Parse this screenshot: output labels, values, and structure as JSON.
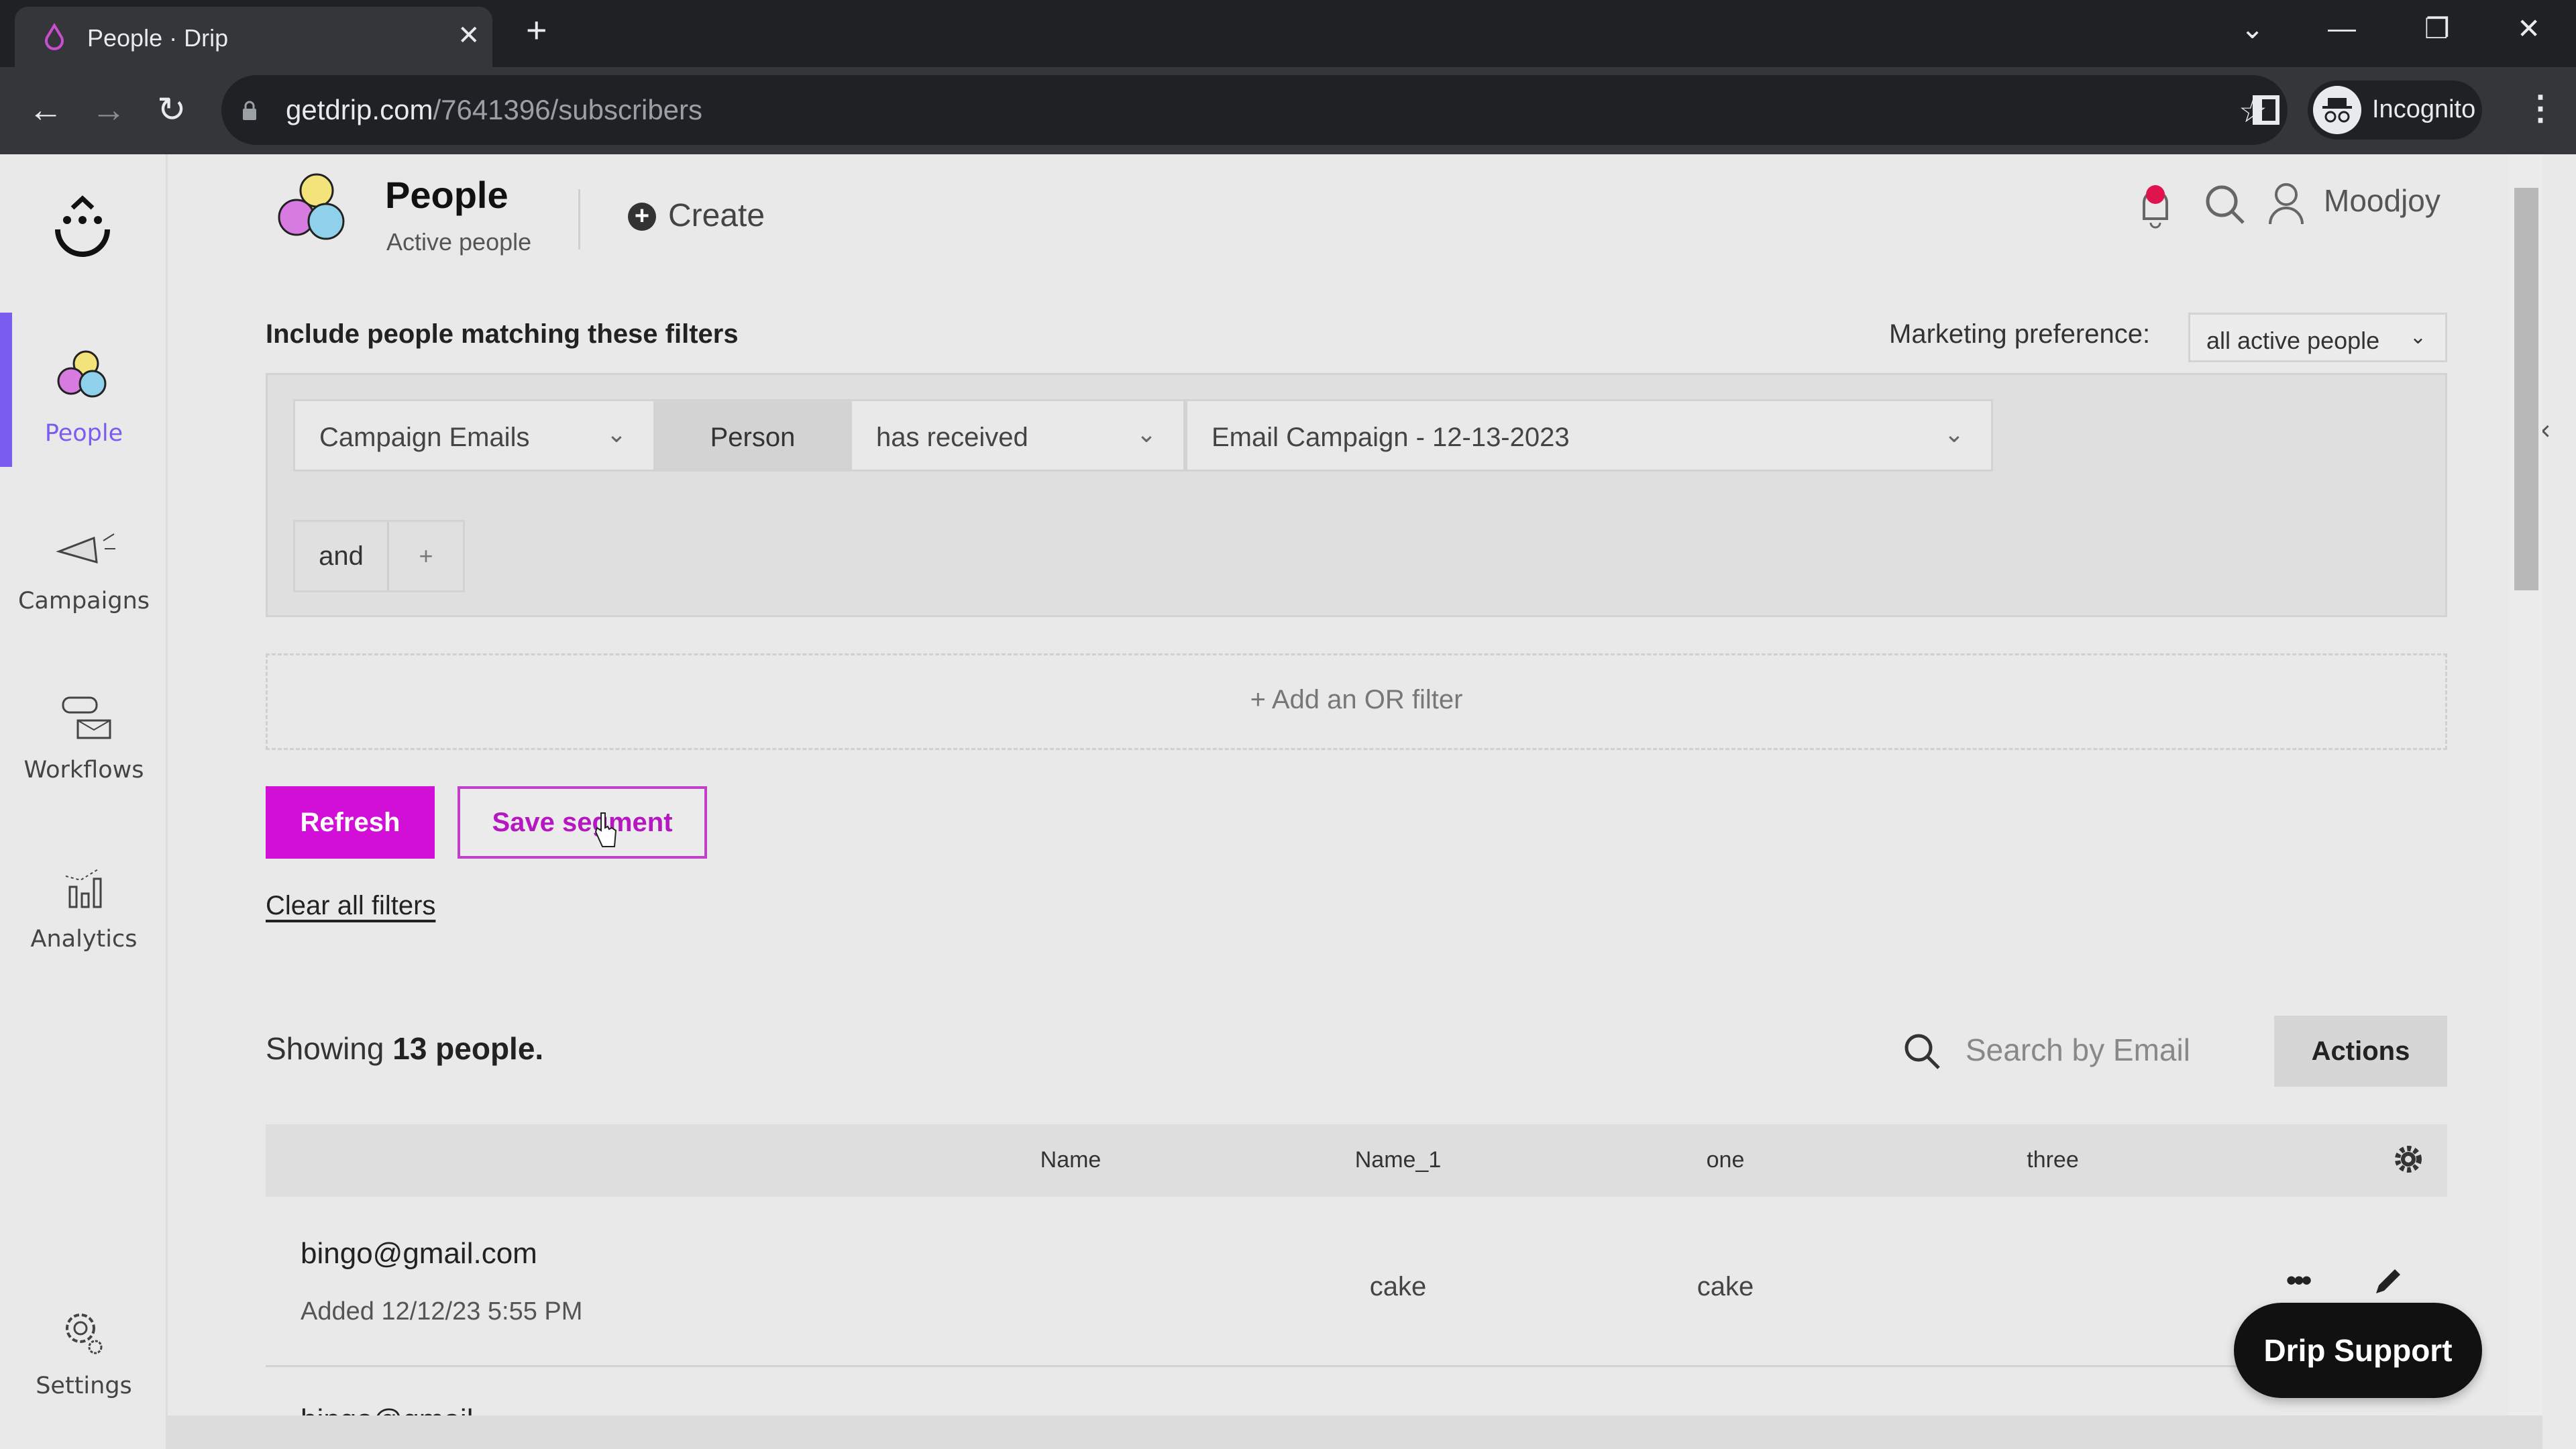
{
  "browser": {
    "tab_title": "People · Drip",
    "url_host": "getdrip.com",
    "url_path": "/7641396/subscribers",
    "profile_label": "Incognito"
  },
  "sidebar": {
    "items": [
      {
        "label": "People",
        "icon": "people-icon",
        "active": true
      },
      {
        "label": "Campaigns",
        "icon": "megaphone-icon",
        "active": false
      },
      {
        "label": "Workflows",
        "icon": "workflow-icon",
        "active": false
      },
      {
        "label": "Analytics",
        "icon": "bar-chart-icon",
        "active": false
      },
      {
        "label": "Settings",
        "icon": "gear-icon",
        "active": false
      }
    ]
  },
  "header": {
    "title": "People",
    "subtitle": "Active people",
    "create_label": "Create",
    "user_name": "Moodjoy"
  },
  "filters": {
    "heading": "Include people matching these filters",
    "marketing_pref_label": "Marketing preference:",
    "marketing_pref_value": "all active people",
    "rule": {
      "type": "Campaign Emails",
      "subject": "Person",
      "operator": "has received",
      "value": "Email Campaign - 12-13-2023",
      "remove": "×"
    },
    "and_label": "and",
    "and_add": "+",
    "or_filter_label": "+  Add an OR filter"
  },
  "buttons": {
    "refresh": "Refresh",
    "save_segment": "Save segment",
    "clear_filters": "Clear all filters"
  },
  "list": {
    "showing_prefix": "Showing ",
    "showing_count": "13 people.",
    "search_placeholder": "Search by Email",
    "actions_label": "Actions",
    "columns": [
      "Name",
      "Name_1",
      "one",
      "three"
    ],
    "rows": [
      {
        "email": "bingo@gmail.com",
        "added": "Added 12/12/23 5:55 PM",
        "name": "",
        "name_1": "cake",
        "one": "cake",
        "three": ""
      }
    ],
    "next_row_partial": "bingo@gmail..."
  },
  "support": {
    "label": "Drip Support"
  },
  "colors": {
    "accent_purple": "#7b5cf0",
    "brand_magenta": "#d10fd6",
    "notification_red": "#e0144c"
  }
}
